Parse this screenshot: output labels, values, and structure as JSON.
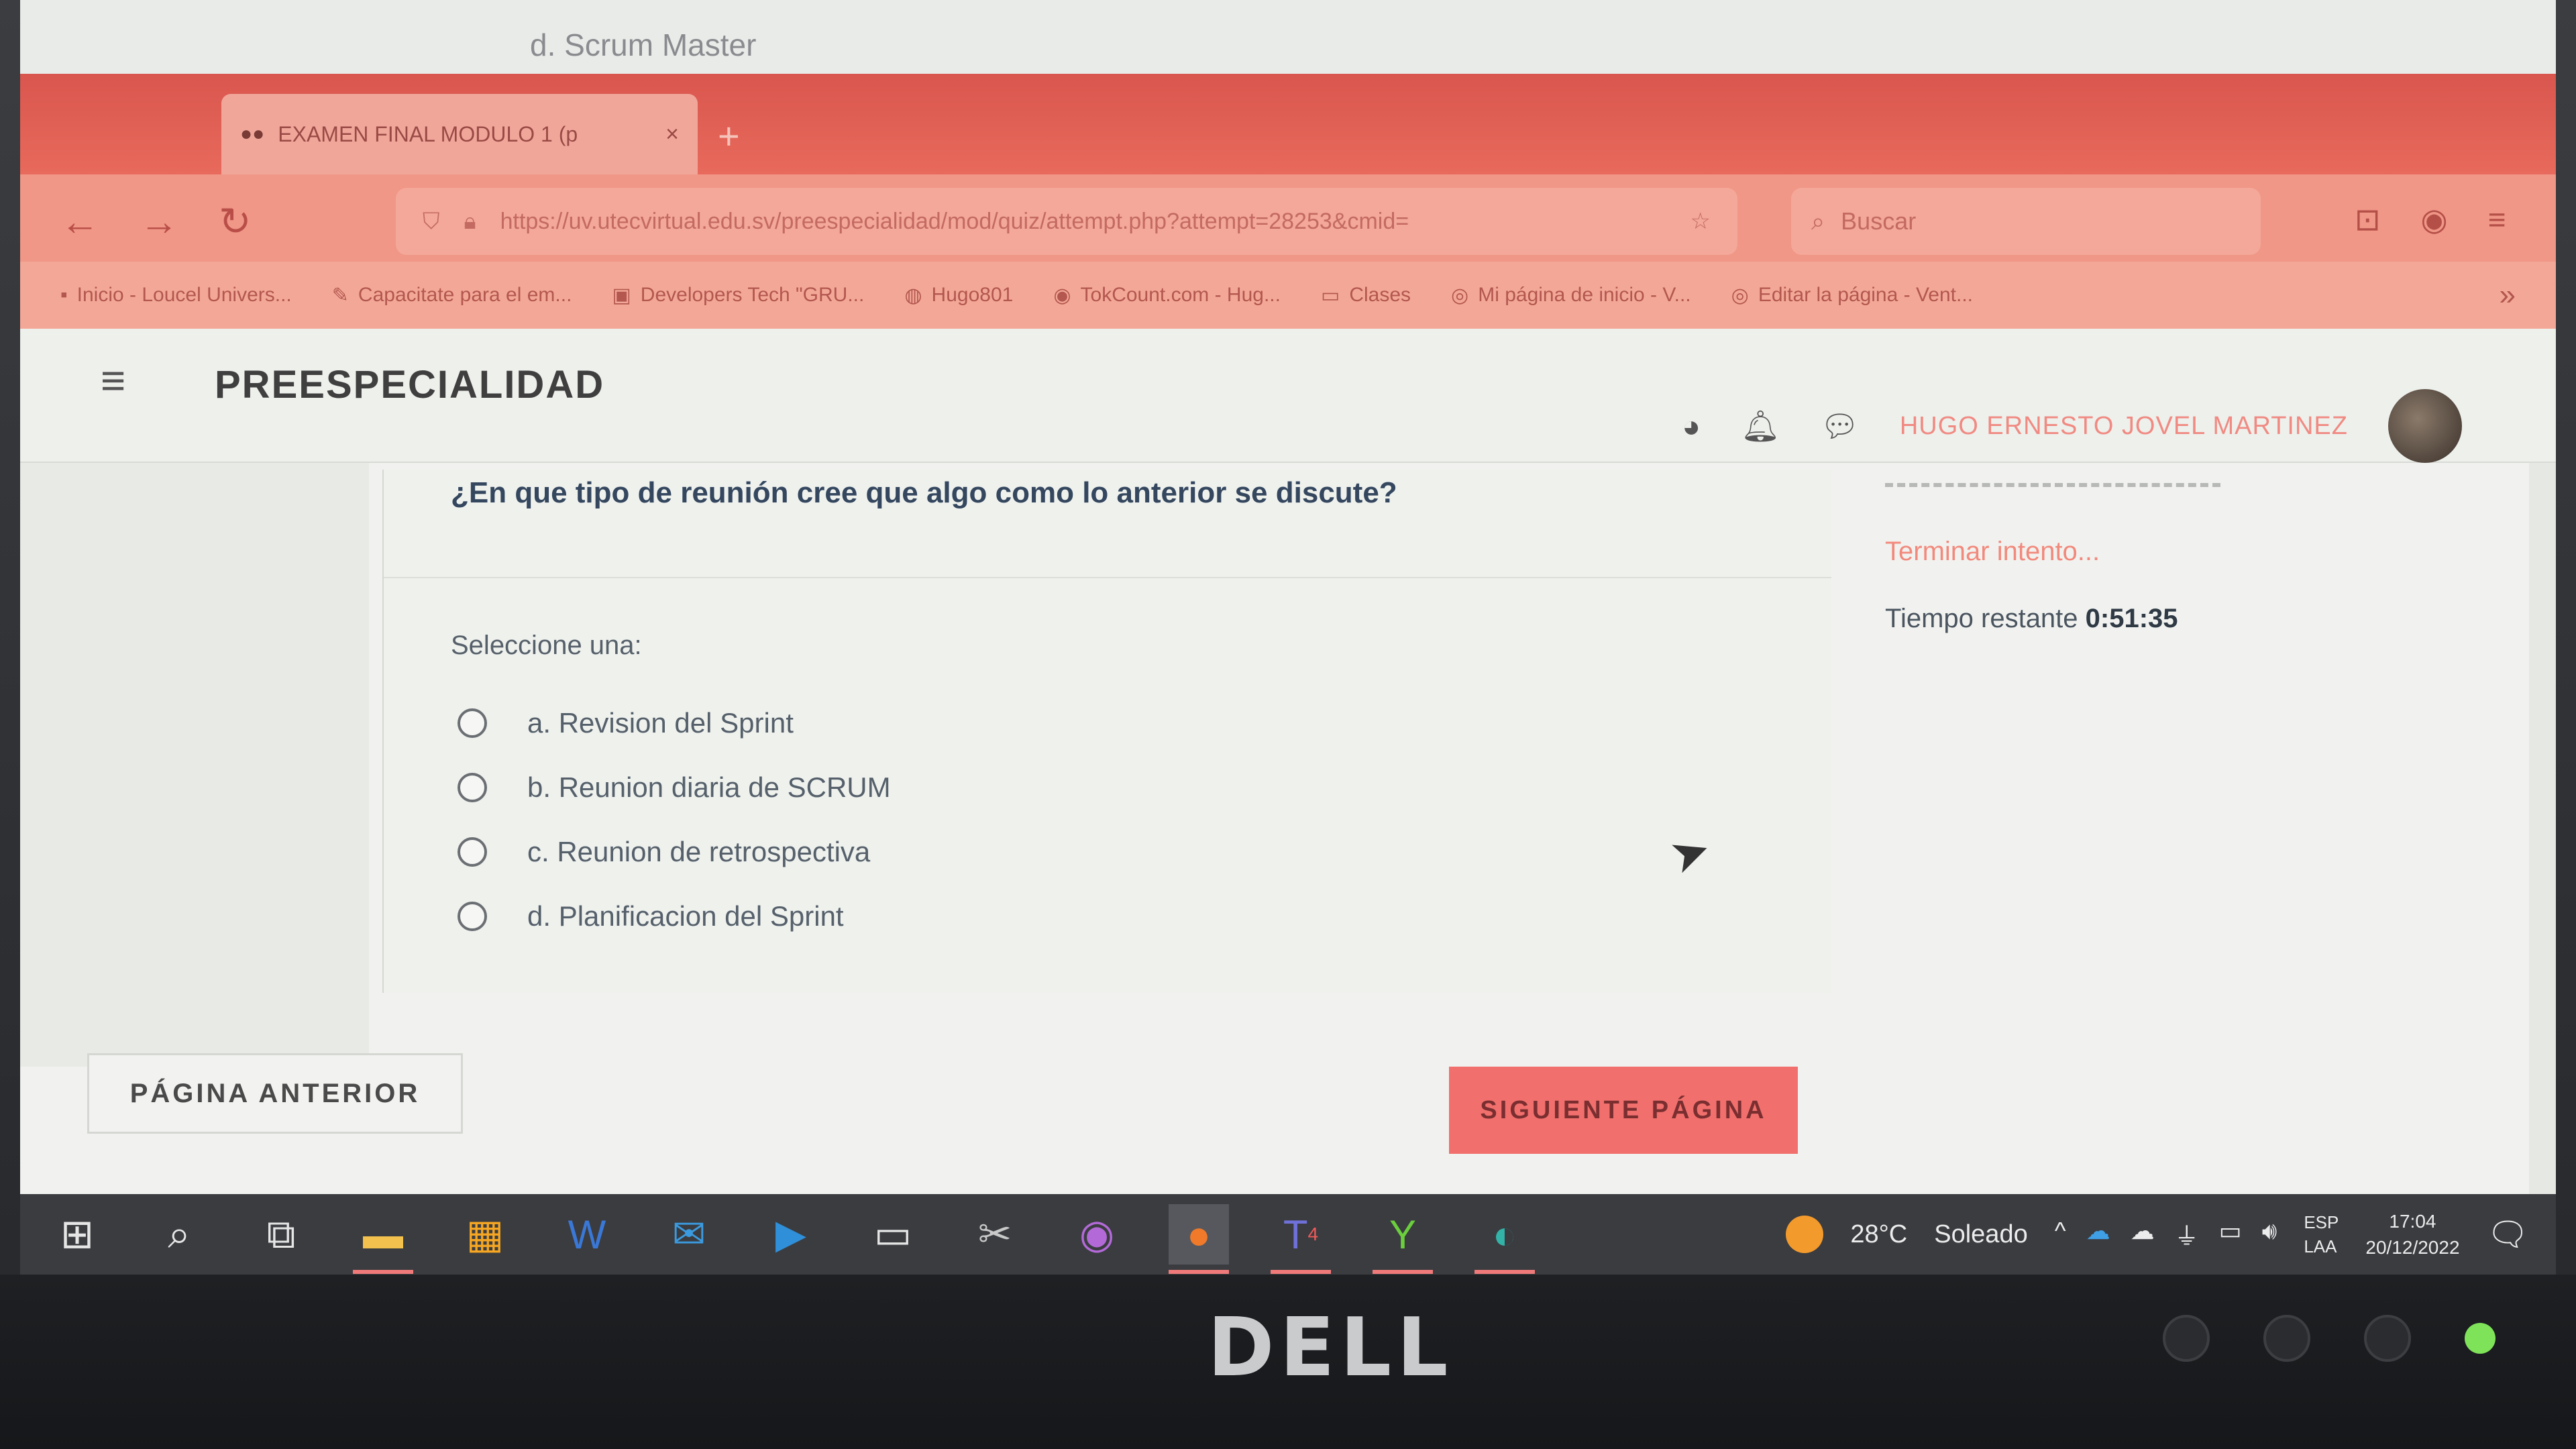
{
  "background_window": {
    "title_fragment": "d. Scrum Master"
  },
  "browser": {
    "tab_title": "EXAMEN FINAL MODULO 1 (p",
    "tab_close": "×",
    "new_tab": "+",
    "url": "https://uv.utecvirtual.edu.sv/preespecialidad/mod/quiz/attempt.php?attempt=28253&cmid=",
    "search_placeholder": "Buscar",
    "bookmarks": [
      {
        "label": "Inicio - Loucel Univers...",
        "icon": "page-icon"
      },
      {
        "label": "Capacitate para el em...",
        "icon": "edit-icon"
      },
      {
        "label": "Developers Tech \"GRU...",
        "icon": "linkedin-icon"
      },
      {
        "label": "Hugo801",
        "icon": "github-icon"
      },
      {
        "label": "TokCount.com - Hug...",
        "icon": "tiktok-icon"
      },
      {
        "label": "Clases",
        "icon": "folder-icon"
      },
      {
        "label": "Mi página de inicio - V...",
        "icon": "globe-icon"
      },
      {
        "label": "Editar la página - Vent...",
        "icon": "globe-icon"
      }
    ]
  },
  "moodle": {
    "site_title": "PREESPECIALIDAD",
    "user_name": "HUGO ERNESTO JOVEL MARTINEZ",
    "question": "¿En que tipo de reunión cree que algo como lo anterior se discute?",
    "select_prompt": "Seleccione una:",
    "options": [
      "a. Revision del Sprint",
      "b. Reunion diaria de SCRUM",
      "c. Reunion de retrospectiva",
      "d. Planificacion del Sprint"
    ],
    "finish_attempt": "Terminar intento...",
    "time_label": "Tiempo restante",
    "time_value": "0:51:35",
    "prev_button": "PÁGINA ANTERIOR",
    "next_button": "SIGUIENTE PÁGINA"
  },
  "taskbar": {
    "weather_temp": "28°C",
    "weather_desc": "Soleado",
    "lang_1": "ESP",
    "lang_2": "LAA",
    "time": "17:04",
    "date": "20/12/2022",
    "teams_badge": "4"
  },
  "monitor": {
    "brand": "DELL"
  },
  "colors": {
    "accent": "#f1706d",
    "browser_chrome": "#e86a5c",
    "question_text": "#34475f",
    "taskbar": "#3a3c40"
  }
}
